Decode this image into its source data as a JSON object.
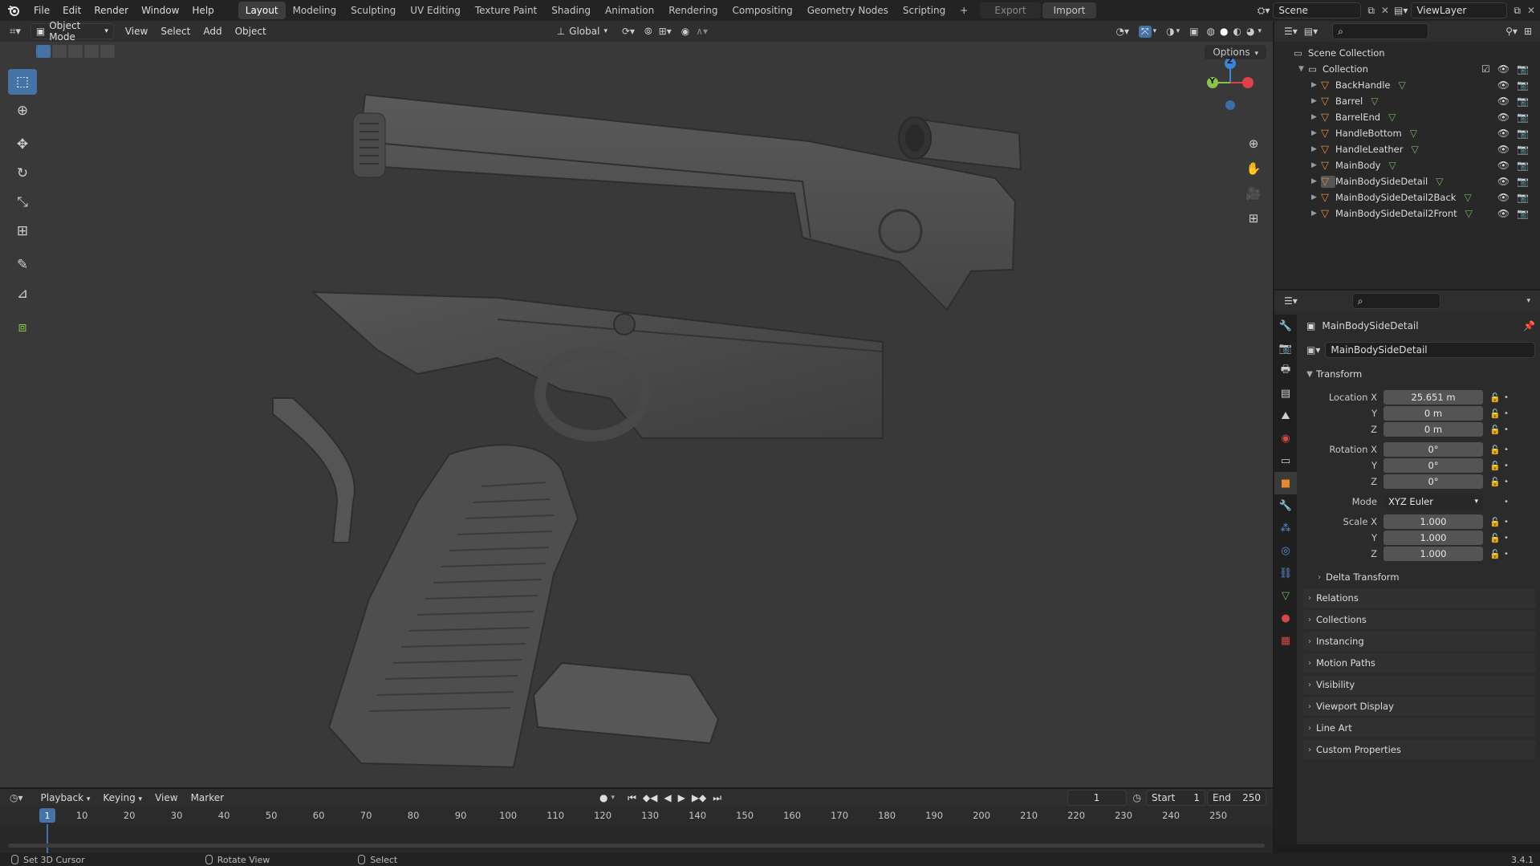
{
  "topbar": {
    "menus": [
      "File",
      "Edit",
      "Render",
      "Window",
      "Help"
    ],
    "workspaces": [
      "Layout",
      "Modeling",
      "Sculpting",
      "UV Editing",
      "Texture Paint",
      "Shading",
      "Animation",
      "Rendering",
      "Compositing",
      "Geometry Nodes",
      "Scripting"
    ],
    "active_workspace": "Layout",
    "add_workspace": "+",
    "export_label": "Export",
    "import_label": "Import",
    "scene_name": "Scene",
    "view_layer_name": "ViewLayer"
  },
  "viewport": {
    "mode": "Object Mode",
    "menus": [
      "View",
      "Select",
      "Add",
      "Object"
    ],
    "transform_orientation": "Global",
    "options_label": "Options",
    "gizmo": {
      "z": "Z",
      "y": "Y"
    }
  },
  "outliner": {
    "root": "Scene Collection",
    "collection": "Collection",
    "objects": [
      "BackHandle",
      "Barrel",
      "BarrelEnd",
      "HandleBottom",
      "HandleLeather",
      "MainBody",
      "MainBodySideDetail",
      "MainBodySideDetail2Back",
      "MainBodySideDetail2Front"
    ]
  },
  "properties": {
    "object_name": "MainBodySideDetail",
    "datablock_name": "MainBodySideDetail",
    "transform_label": "Transform",
    "location": {
      "label": "Location X",
      "x": "25.651 m",
      "y": "0 m",
      "z": "0 m"
    },
    "rotation": {
      "label": "Rotation X",
      "x": "0°",
      "y": "0°",
      "z": "0°"
    },
    "axis_y": "Y",
    "axis_z": "Z",
    "mode_label": "Mode",
    "mode_value": "XYZ Euler",
    "scale": {
      "label": "Scale X",
      "x": "1.000",
      "y": "1.000",
      "z": "1.000"
    },
    "delta_transform": "Delta Transform",
    "panels": [
      "Relations",
      "Collections",
      "Instancing",
      "Motion Paths",
      "Visibility",
      "Viewport Display",
      "Line Art",
      "Custom Properties"
    ]
  },
  "timeline": {
    "menus": [
      "Playback",
      "Keying",
      "View",
      "Marker"
    ],
    "current_frame": "1",
    "start_label": "Start",
    "start_value": "1",
    "end_label": "End",
    "end_value": "250",
    "ticks": [
      "10",
      "20",
      "30",
      "40",
      "50",
      "60",
      "70",
      "80",
      "90",
      "100",
      "110",
      "120",
      "130",
      "140",
      "150",
      "160",
      "170",
      "180",
      "190",
      "200",
      "210",
      "220",
      "230",
      "240",
      "250"
    ],
    "playhead": "1"
  },
  "statusbar": {
    "items": [
      "Set 3D Cursor",
      "Rotate View",
      "Select"
    ],
    "version": "3.4.1"
  },
  "colors": {
    "accent": "#4673a6",
    "object_orange": "#e6892e",
    "mesh_green": "#6cba5a",
    "axis_x": "#e0404a",
    "axis_y": "#8bc34a",
    "axis_z": "#3d85d6"
  }
}
